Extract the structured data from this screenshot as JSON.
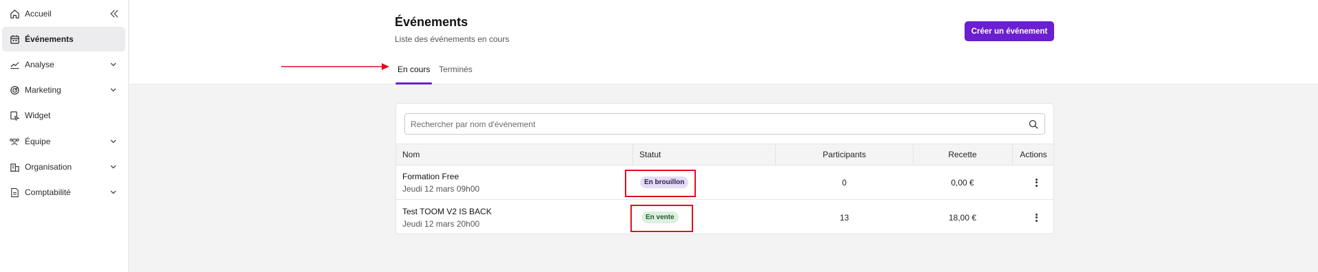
{
  "sidebar": {
    "collapse_icon": "double-chevron-left-icon",
    "items": [
      {
        "label": "Accueil",
        "icon": "home-icon",
        "has_children": false,
        "active": false
      },
      {
        "label": "Événements",
        "icon": "calendar-icon",
        "has_children": false,
        "active": true
      },
      {
        "label": "Analyse",
        "icon": "chart-line-icon",
        "has_children": true,
        "active": false
      },
      {
        "label": "Marketing",
        "icon": "target-icon",
        "has_children": true,
        "active": false
      },
      {
        "label": "Widget",
        "icon": "widget-icon",
        "has_children": false,
        "active": false
      },
      {
        "label": "Équipe",
        "icon": "users-icon",
        "has_children": true,
        "active": false
      },
      {
        "label": "Organisation",
        "icon": "building-icon",
        "has_children": true,
        "active": false
      },
      {
        "label": "Comptabilité",
        "icon": "document-icon",
        "has_children": true,
        "active": false
      }
    ]
  },
  "header": {
    "title": "Événements",
    "subtitle": "Liste des événements en cours",
    "create_button": "Créer un événement"
  },
  "tabs": [
    {
      "label": "En cours",
      "active": true
    },
    {
      "label": "Terminés",
      "active": false
    }
  ],
  "search": {
    "placeholder": "Rechercher par nom d'événement",
    "value": ""
  },
  "table": {
    "columns": [
      "Nom",
      "Statut",
      "Participants",
      "Recette",
      "Actions"
    ],
    "rows": [
      {
        "name": "Formation Free",
        "date": "Jeudi 12 mars 09h00",
        "status": "En brouillon",
        "participants": "0",
        "revenue": "0,00 €"
      },
      {
        "name": "Test TOOM V2 IS BACK",
        "date": "Jeudi 12 mars 20h00",
        "status": "En vente",
        "participants": "13",
        "revenue": "18,00 €"
      }
    ]
  },
  "colors": {
    "accent": "#6a1fd0",
    "annotation": "#e00d1f",
    "badge_draft_bg": "#e6dcf6",
    "badge_sale_bg": "#dcefe0"
  }
}
